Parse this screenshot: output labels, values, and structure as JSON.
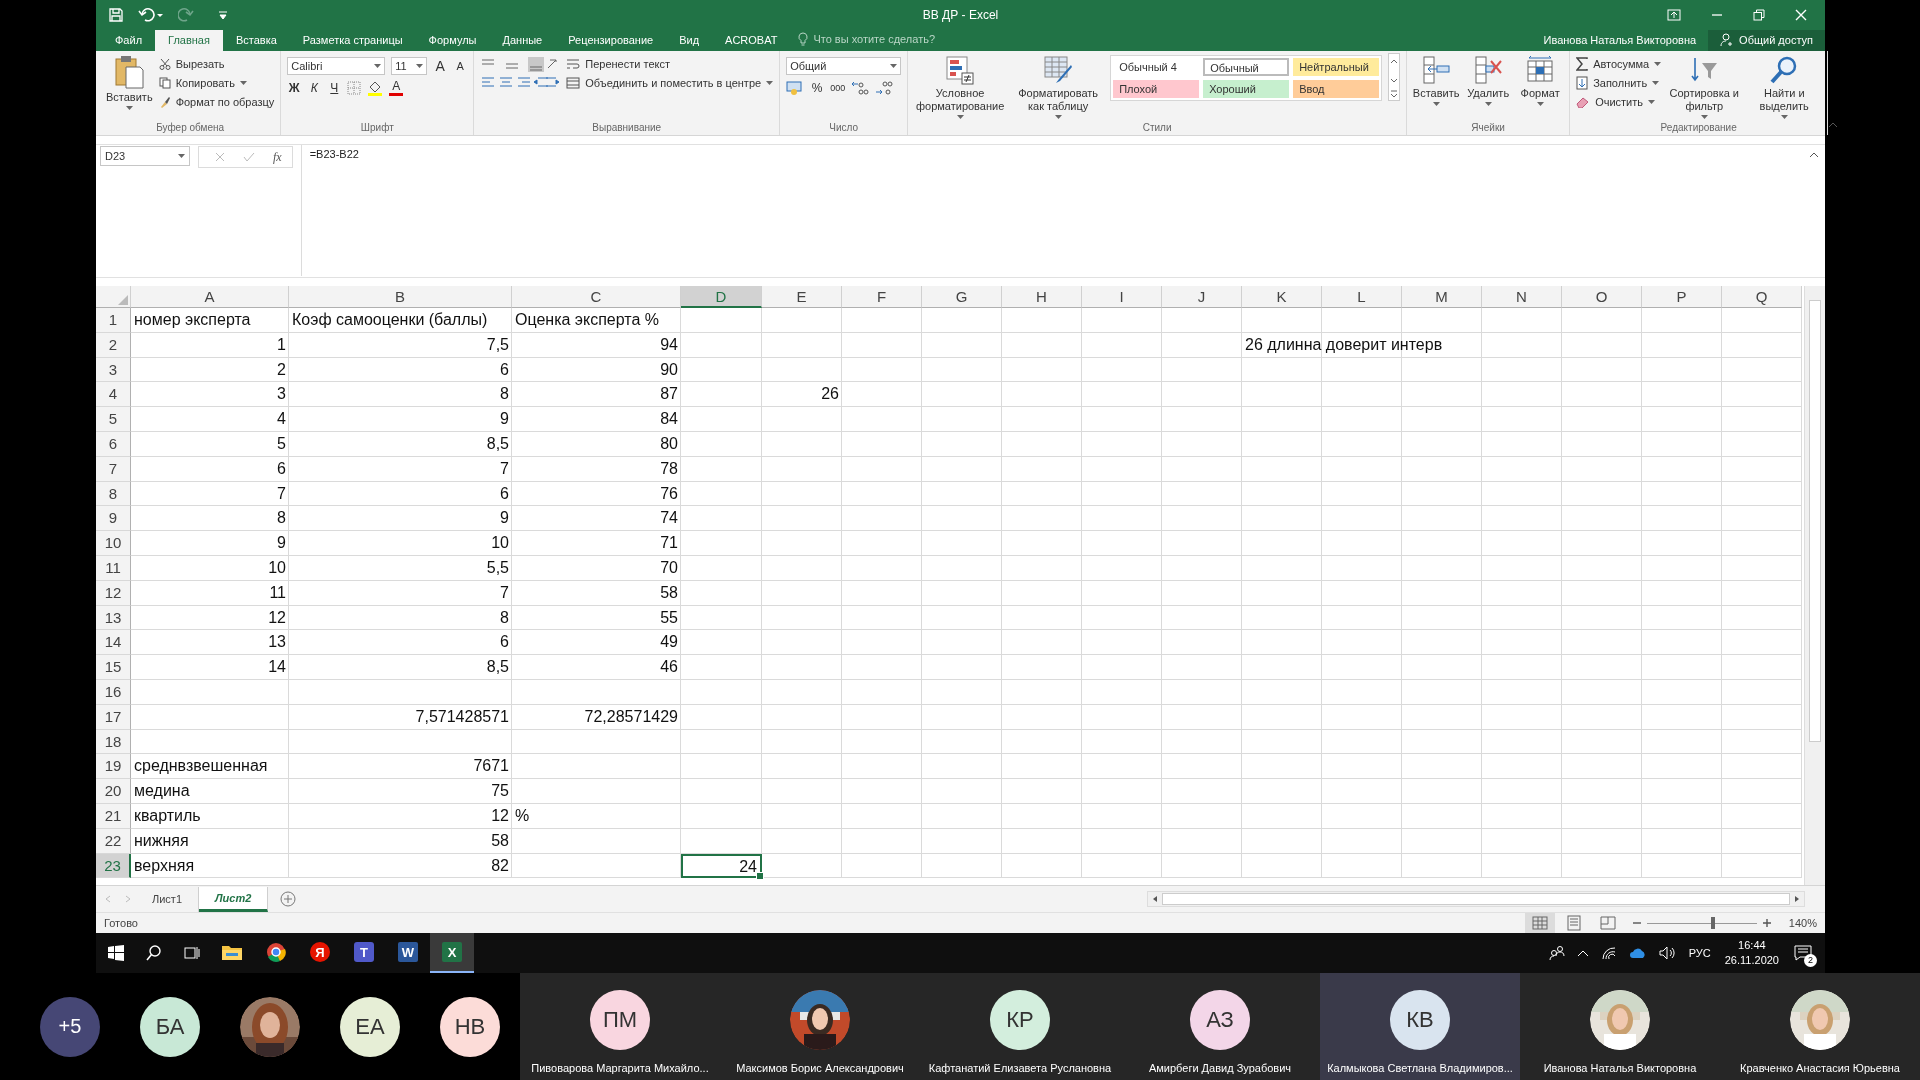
{
  "window": {
    "title": "ВВ ДР - Excel",
    "user": "Иванова Наталья Викторовна",
    "share": "Общий доступ"
  },
  "ribbon_tabs": [
    {
      "label": "Файл",
      "selected": false
    },
    {
      "label": "Главная",
      "selected": true
    },
    {
      "label": "Вставка",
      "selected": false
    },
    {
      "label": "Разметка страницы",
      "selected": false
    },
    {
      "label": "Формулы",
      "selected": false
    },
    {
      "label": "Данные",
      "selected": false
    },
    {
      "label": "Рецензирование",
      "selected": false
    },
    {
      "label": "Вид",
      "selected": false
    },
    {
      "label": "ACROBAT",
      "selected": false
    }
  ],
  "search_hint": "Что вы хотите сделать?",
  "clipboard": {
    "paste": "Вставить",
    "cut": "Вырезать",
    "copy": "Копировать",
    "painter": "Формат по образцу",
    "label": "Буфер обмена"
  },
  "font": {
    "family": "Calibri",
    "size": "11",
    "label": "Шрифт",
    "buttons": [
      {
        "kind": "grow",
        "label": "A"
      },
      {
        "kind": "shrink",
        "label": "A"
      },
      {
        "kind": "bold",
        "label": "Ж"
      },
      {
        "kind": "italic",
        "label": "К"
      },
      {
        "kind": "underline",
        "label": "Ч"
      },
      {
        "kind": "borders"
      },
      {
        "kind": "fill"
      },
      {
        "kind": "color",
        "label": "A"
      }
    ]
  },
  "alignment": {
    "wrap": "Перенести текст",
    "merge": "Объединить и поместить в центре",
    "label": "Выравнивание"
  },
  "number": {
    "format": "Общий",
    "percent": "%",
    "thousands": "000",
    "label": "Число"
  },
  "styles": {
    "conditional": "Условное форматирование",
    "as_table": "Форматировать как таблицу",
    "label": "Стили",
    "items": [
      {
        "label": "Обычный 4",
        "color": "#ffffff",
        "selected": false
      },
      {
        "label": "Обычный",
        "color": "#ffffff",
        "selected": true
      },
      {
        "label": "Нейтральный",
        "color": "#ffeb9c",
        "selected": false
      },
      {
        "label": "Плохой",
        "color": "#ffc7ce",
        "selected": false
      },
      {
        "label": "Хороший",
        "color": "#c6efce",
        "selected": false
      },
      {
        "label": "Ввод",
        "color": "#ffcc99",
        "selected": false
      }
    ]
  },
  "cells": {
    "insert": "Вставить",
    "delete": "Удалить",
    "format": "Формат",
    "label": "Ячейки"
  },
  "editing": {
    "autosum": "Автосумма",
    "fill": "Заполнить",
    "clear": "Очистить",
    "sort": "Сортировка и фильтр",
    "find": "Найти и выделить",
    "label": "Редактирование"
  },
  "formula_bar": {
    "name_box": "D23",
    "fx": "fx",
    "formula": "=B23-B22"
  },
  "columns": [
    {
      "letter": "A",
      "selected": false
    },
    {
      "letter": "B",
      "selected": false
    },
    {
      "letter": "C",
      "selected": false
    },
    {
      "letter": "D",
      "selected": true
    },
    {
      "letter": "E",
      "selected": false
    },
    {
      "letter": "F",
      "selected": false
    },
    {
      "letter": "G",
      "selected": false
    },
    {
      "letter": "H",
      "selected": false
    },
    {
      "letter": "I",
      "selected": false
    },
    {
      "letter": "J",
      "selected": false
    },
    {
      "letter": "K",
      "selected": false
    },
    {
      "letter": "L",
      "selected": false
    },
    {
      "letter": "M",
      "selected": false
    },
    {
      "letter": "N",
      "selected": false
    },
    {
      "letter": "O",
      "selected": false
    },
    {
      "letter": "P",
      "selected": false
    },
    {
      "letter": "Q",
      "selected": false
    }
  ],
  "rows": [
    {
      "number": "1",
      "A": {
        "text": "номер эксперта",
        "kind": "text",
        "selected": false
      },
      "B": {
        "text": "Коэф самооценки (баллы)",
        "kind": "text",
        "selected": false
      },
      "C": {
        "text": "Оценка эксперта %",
        "kind": "text",
        "selected": false
      }
    },
    {
      "number": "2",
      "A": {
        "text": "1",
        "kind": "number",
        "selected": false
      },
      "B": {
        "text": "7,5",
        "kind": "number",
        "selected": false
      },
      "C": {
        "text": "94",
        "kind": "number",
        "selected": false
      },
      "K": {
        "text": "26 длинна доверит интерв",
        "kind": "text",
        "selected": false
      }
    },
    {
      "number": "3",
      "A": {
        "text": "2",
        "kind": "number",
        "selected": false
      },
      "B": {
        "text": "6",
        "kind": "number",
        "selected": false
      },
      "C": {
        "text": "90",
        "kind": "number",
        "selected": false
      }
    },
    {
      "number": "4",
      "A": {
        "text": "3",
        "kind": "number",
        "selected": false
      },
      "B": {
        "text": "8",
        "kind": "number",
        "selected": false
      },
      "C": {
        "text": "87",
        "kind": "number",
        "selected": false
      },
      "E": {
        "text": "26",
        "kind": "number",
        "selected": false
      }
    },
    {
      "number": "5",
      "A": {
        "text": "4",
        "kind": "number",
        "selected": false
      },
      "B": {
        "text": "9",
        "kind": "number",
        "selected": false
      },
      "C": {
        "text": "84",
        "kind": "number",
        "selected": false
      }
    },
    {
      "number": "6",
      "A": {
        "text": "5",
        "kind": "number",
        "selected": false
      },
      "B": {
        "text": "8,5",
        "kind": "number",
        "selected": false
      },
      "C": {
        "text": "80",
        "kind": "number",
        "selected": false
      }
    },
    {
      "number": "7",
      "A": {
        "text": "6",
        "kind": "number",
        "selected": false
      },
      "B": {
        "text": "7",
        "kind": "number",
        "selected": false
      },
      "C": {
        "text": "78",
        "kind": "number",
        "selected": false
      }
    },
    {
      "number": "8",
      "A": {
        "text": "7",
        "kind": "number",
        "selected": false
      },
      "B": {
        "text": "6",
        "kind": "number",
        "selected": false
      },
      "C": {
        "text": "76",
        "kind": "number",
        "selected": false
      }
    },
    {
      "number": "9",
      "A": {
        "text": "8",
        "kind": "number",
        "selected": false
      },
      "B": {
        "text": "9",
        "kind": "number",
        "selected": false
      },
      "C": {
        "text": "74",
        "kind": "number",
        "selected": false
      }
    },
    {
      "number": "10",
      "A": {
        "text": "9",
        "kind": "number",
        "selected": false
      },
      "B": {
        "text": "10",
        "kind": "number",
        "selected": false
      },
      "C": {
        "text": "71",
        "kind": "number",
        "selected": false
      }
    },
    {
      "number": "11",
      "A": {
        "text": "10",
        "kind": "number",
        "selected": false
      },
      "B": {
        "text": "5,5",
        "kind": "number",
        "selected": false
      },
      "C": {
        "text": "70",
        "kind": "number",
        "selected": false
      }
    },
    {
      "number": "12",
      "A": {
        "text": "11",
        "kind": "number",
        "selected": false
      },
      "B": {
        "text": "7",
        "kind": "number",
        "selected": false
      },
      "C": {
        "text": "58",
        "kind": "number",
        "selected": false
      }
    },
    {
      "number": "13",
      "A": {
        "text": "12",
        "kind": "number",
        "selected": false
      },
      "B": {
        "text": "8",
        "kind": "number",
        "selected": false
      },
      "C": {
        "text": "55",
        "kind": "number",
        "selected": false
      }
    },
    {
      "number": "14",
      "A": {
        "text": "13",
        "kind": "number",
        "selected": false
      },
      "B": {
        "text": "6",
        "kind": "number",
        "selected": false
      },
      "C": {
        "text": "49",
        "kind": "number",
        "selected": false
      }
    },
    {
      "number": "15",
      "A": {
        "text": "14",
        "kind": "number",
        "selected": false
      },
      "B": {
        "text": "8,5",
        "kind": "number",
        "selected": false
      },
      "C": {
        "text": "46",
        "kind": "number",
        "selected": false
      }
    },
    {
      "number": "16"
    },
    {
      "number": "17",
      "B": {
        "text": "7,571428571",
        "kind": "number",
        "selected": false
      },
      "C": {
        "text": "72,28571429",
        "kind": "number",
        "selected": false
      }
    },
    {
      "number": "18"
    },
    {
      "number": "19",
      "A": {
        "text": "среднвзвешенная",
        "kind": "text",
        "selected": false
      },
      "B": {
        "text": "7671",
        "kind": "number",
        "selected": false
      }
    },
    {
      "number": "20",
      "A": {
        "text": "медина",
        "kind": "text",
        "selected": false
      },
      "B": {
        "text": "75",
        "kind": "number",
        "selected": false
      }
    },
    {
      "number": "21",
      "A": {
        "text": "квартиль",
        "kind": "text",
        "selected": false
      },
      "B": {
        "text": "12",
        "kind": "number",
        "selected": false
      },
      "C": {
        "text": "%",
        "kind": "text",
        "selected": false
      }
    },
    {
      "number": "22",
      "A": {
        "text": "нижняя",
        "kind": "text",
        "selected": false
      },
      "B": {
        "text": "58",
        "kind": "number",
        "selected": false
      }
    },
    {
      "number": "23",
      "A": {
        "text": "верхняя",
        "kind": "text",
        "selected": false
      },
      "B": {
        "text": "82",
        "kind": "number",
        "selected": false
      },
      "D": {
        "text": "24",
        "kind": "number",
        "selected": true
      }
    }
  ],
  "sheet_tabs": [
    {
      "label": "Лист1",
      "selected": false
    },
    {
      "label": "Лист2",
      "selected": true
    }
  ],
  "status": {
    "text": "Готово",
    "zoom": "140%",
    "zoom_level": {
      "level": 0.6
    }
  },
  "taskbar": {
    "apps": [
      {
        "kind": "start"
      },
      {
        "kind": "search"
      },
      {
        "kind": "taskview"
      },
      {
        "kind": "explorer",
        "selected": false
      },
      {
        "kind": "chrome",
        "selected": false
      },
      {
        "kind": "yandex",
        "label": "Я",
        "selected": false
      },
      {
        "kind": "teams",
        "label": "T",
        "selected": false
      },
      {
        "kind": "word",
        "label": "W",
        "selected": false
      },
      {
        "kind": "excel",
        "label": "X",
        "selected": true
      }
    ],
    "language": "РУС",
    "time": "16:44",
    "date": "26.11.2020",
    "notifications": "2"
  },
  "call_strip": {
    "overflow": "+5",
    "avatars": [
      {
        "initials": "БА",
        "color": "#c8e8d6"
      },
      {
        "kind": "picture"
      },
      {
        "initials": "ЕА",
        "color": "#e6eed6"
      },
      {
        "initials": "НВ",
        "color": "#fcdcd8"
      }
    ],
    "tiles": [
      {
        "initials": "ПМ",
        "color": "#f9d6e0",
        "name": "Пивоварова Маргарита Михайло...",
        "speaking": false
      },
      {
        "kind": "picture",
        "name": "Максимов Борис Александрович",
        "speaking": false
      },
      {
        "initials": "КР",
        "color": "#d3eedd",
        "name": "Кафтанатий Елизавета Руслановна",
        "speaking": false
      },
      {
        "initials": "АЗ",
        "color": "#f3d6e8",
        "name": "Амирбеги Давид Зурабович",
        "speaking": false
      },
      {
        "initials": "КВ",
        "color": "#d9e4ef",
        "name": "Калмыкова Светлана Владимиров...",
        "speaking": true
      },
      {
        "kind": "picture",
        "name": "Иванова Наталья Викторовна",
        "speaking": false
      },
      {
        "kind": "picture",
        "name": "Кравченко Анастасия Юрьевна",
        "speaking": false
      }
    ]
  }
}
